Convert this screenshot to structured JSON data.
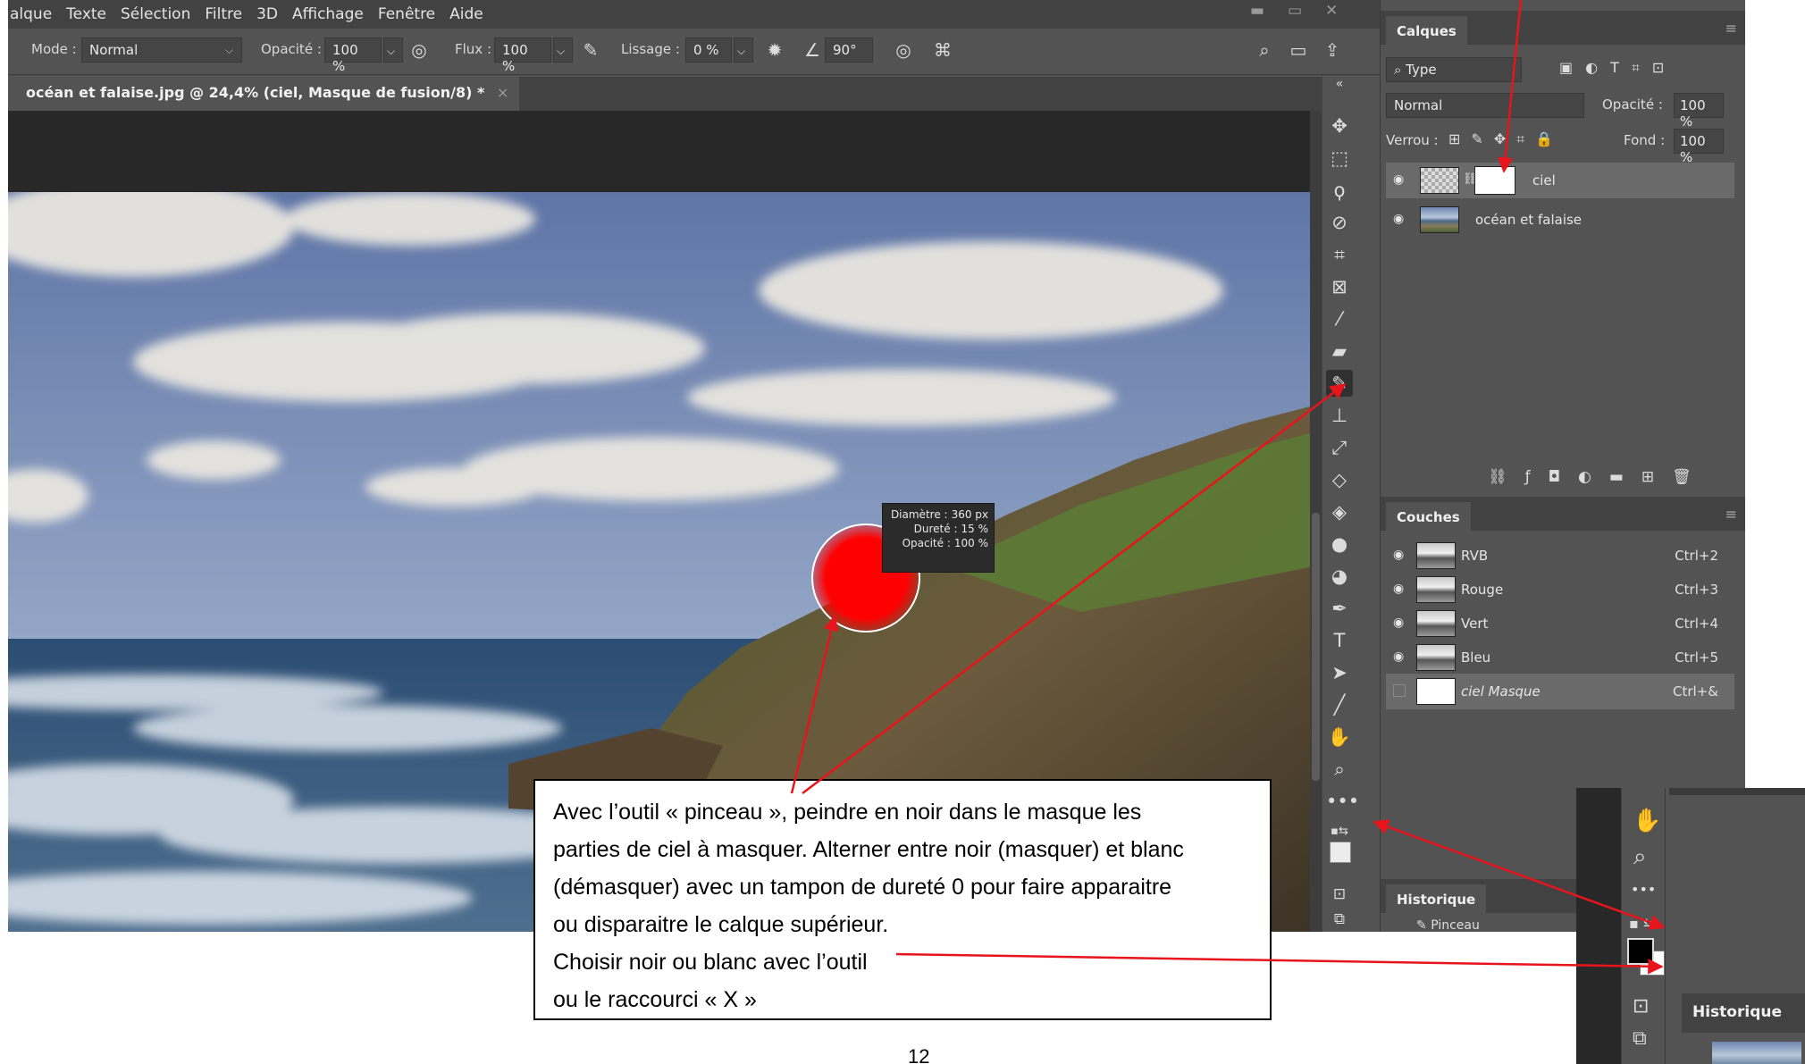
{
  "menu": {
    "items": [
      "alque",
      "Texte",
      "Sélection",
      "Filtre",
      "3D",
      "Affichage",
      "Fenêtre",
      "Aide"
    ]
  },
  "options": {
    "mode_label": "Mode :",
    "mode_value": "Normal",
    "opacity_label": "Opacité :",
    "opacity_value": "100 %",
    "flow_label": "Flux :",
    "flow_value": "100 %",
    "smoothing_label": "Lissage :",
    "smoothing_value": "0 %",
    "angle_value": "90°"
  },
  "document_tab": {
    "title": "océan et falaise.jpg @ 24,4% (ciel, Masque de fusion/8) *",
    "close": "×"
  },
  "brush_tooltip": {
    "diameter_label": "Diamètre :",
    "diameter_value": "360 px",
    "hardness_label": "Dureté :",
    "hardness_value": "15 %",
    "opacity_label": "Opacité :",
    "opacity_value": "100 %"
  },
  "layers_panel": {
    "title": "Calques",
    "filter_label": "Type",
    "blend_mode": "Normal",
    "opacity_label": "Opacité :",
    "opacity_value": "100 %",
    "lock_label": "Verrou :",
    "fill_label": "Fond :",
    "fill_value": "100 %",
    "layers": [
      {
        "name": "ciel"
      },
      {
        "name": "océan et falaise"
      }
    ]
  },
  "channels_panel": {
    "title": "Couches",
    "channels": [
      {
        "name": "RVB",
        "shortcut": "Ctrl+2"
      },
      {
        "name": "Rouge",
        "shortcut": "Ctrl+3"
      },
      {
        "name": "Vert",
        "shortcut": "Ctrl+4"
      },
      {
        "name": "Bleu",
        "shortcut": "Ctrl+5"
      },
      {
        "name": "ciel Masque",
        "shortcut": "Ctrl+&"
      }
    ]
  },
  "history_panel": {
    "title": "Historique",
    "item": "Pinceau"
  },
  "annotation": {
    "lines": [
      "Avec l’outil « pinceau », peindre en noir dans le masque les",
      "parties de ciel à masquer.  Alterner entre noir (masquer) et blanc",
      "(démasquer) avec un tampon de dureté 0 pour faire apparaitre",
      "ou disparaitre le calque supérieur.",
      "Choisir noir ou blanc avec l’outil",
      "ou le raccourci « X »"
    ]
  },
  "inset": {
    "history_title": "Historique"
  },
  "page_number": "12",
  "colors": {
    "arrow": "#e8141c",
    "brush_cursor": "#ff0000",
    "ui_bg": "#535353",
    "ui_dark": "#424242"
  }
}
